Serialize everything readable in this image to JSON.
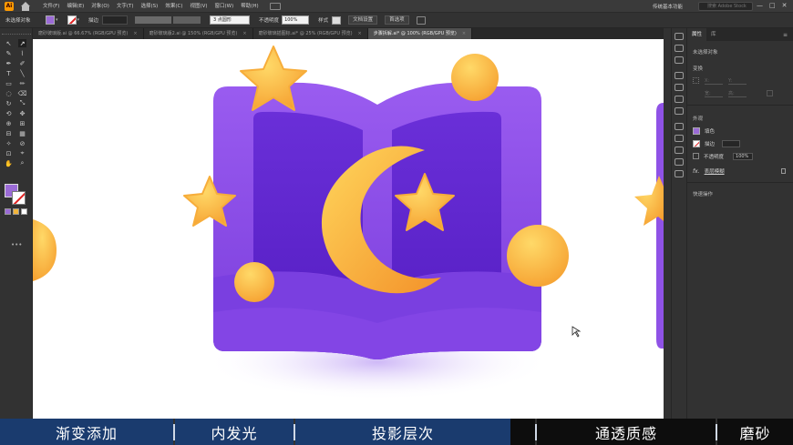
{
  "app": {
    "logo": "Ai"
  },
  "menu": [
    "文件(F)",
    "编辑(E)",
    "对象(O)",
    "文字(T)",
    "选择(S)",
    "效果(C)",
    "视图(V)",
    "窗口(W)",
    "帮助(H)"
  ],
  "workspace": "传统基本功能",
  "stock_search_placeholder": "搜索 Adobe Stock",
  "window_buttons": [
    "—",
    "□",
    "✕"
  ],
  "control": {
    "selection": "未选择对象",
    "stroke_label": "描边",
    "brush": "3 点圆形",
    "opacity_label": "不透明度",
    "opacity": "100%",
    "style_label": "样式",
    "doc_setup": "文档设置",
    "prefs": "首选项"
  },
  "tabs": [
    {
      "label": "磨砂玻璃版.ai @ 66.67% (RGB/GPU 预览)",
      "active": false
    },
    {
      "label": "磨砂玻璃版2.ai @ 150% (RGB/GPU 预览)",
      "active": false
    },
    {
      "label": "磨砂玻璃插图标.ai* @ 25% (RGB/GPU 预览)",
      "active": false
    },
    {
      "label": "步骤拆解.ai* @ 100% (RGB/GPU 预览)",
      "active": true
    }
  ],
  "tools": [
    "↖",
    "↗",
    "✎",
    "⌇",
    "✒",
    "✐",
    "T",
    "╲",
    "▭",
    "✏",
    "◌",
    "⌫",
    "↻",
    "⤡",
    "⟲",
    "✥",
    "⊕",
    "⊞",
    "⊟",
    "▦",
    "✧",
    "⊘",
    "⊡",
    "⌖",
    "✋",
    "⌕"
  ],
  "properties": {
    "tabs": [
      "属性",
      "库"
    ],
    "no_selection": "未选择对象",
    "transform_label": "变换",
    "x_label": "X:",
    "y_label": "Y:",
    "w_label": "宽:",
    "h_label": "高:",
    "appearance_label": "外观",
    "fill_label": "填色",
    "stroke_label": "描边",
    "opacity_label": "不透明度",
    "opacity_value": "100%",
    "fx_symbol": "fx.",
    "effect_link": "表层模糊",
    "quick_actions_label": "快速操作"
  },
  "subtitles": [
    "渐变添加",
    "内发光",
    "投影层次",
    "通透质感",
    "磨砂"
  ],
  "colors": {
    "book_purple": "#8a4ee0",
    "book_inner": "#6b2fd6",
    "moon_yellow": "#ffc53d",
    "moon_orange": "#f59a2b",
    "fill_swatch": "#9b6bd6",
    "subtitle_blue": "#1a3b6e"
  }
}
